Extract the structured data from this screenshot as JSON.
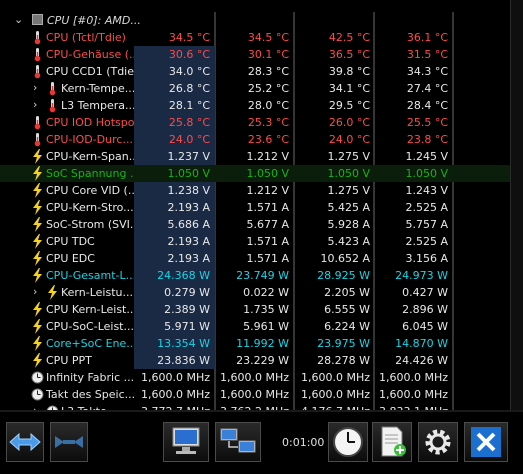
{
  "window": {
    "title": ""
  },
  "header": {
    "label": "CPU [#0]: AMD..."
  },
  "colors": {
    "red": "#ff4b4b",
    "green": "#19b219",
    "cyan": "#15d6e8",
    "white": "#e8e8e8",
    "highlight": "#1a2a44"
  },
  "rows": [
    {
      "label": "CPU (Tctl/Tdie)",
      "v": [
        "34.5 °C",
        "34.5 °C",
        "42.5 °C",
        "36.1 °C"
      ],
      "color": "red",
      "icon": "thermometer-icon",
      "indent": 0,
      "chev": false,
      "hl": false
    },
    {
      "label": "CPU-Gehäuse (...",
      "v": [
        "30.6 °C",
        "30.1 °C",
        "36.5 °C",
        "31.5 °C"
      ],
      "color": "red",
      "icon": "thermometer-icon",
      "indent": 0,
      "chev": false,
      "hl": true
    },
    {
      "label": "CPU CCD1 (Tdie)",
      "v": [
        "34.0 °C",
        "28.3 °C",
        "39.8 °C",
        "34.3 °C"
      ],
      "color": "white",
      "icon": "thermometer-icon",
      "indent": 0,
      "chev": false,
      "hl": true
    },
    {
      "label": "Kern-Tempe...",
      "v": [
        "26.8 °C",
        "25.2 °C",
        "34.1 °C",
        "27.4 °C"
      ],
      "color": "white",
      "icon": "thermometer-icon",
      "indent": 1,
      "chev": true,
      "hl": true
    },
    {
      "label": "L3 Tempera...",
      "v": [
        "28.1 °C",
        "28.0 °C",
        "29.5 °C",
        "28.4 °C"
      ],
      "color": "white",
      "icon": "thermometer-icon",
      "indent": 1,
      "chev": true,
      "hl": true
    },
    {
      "label": "CPU IOD Hotspot",
      "v": [
        "25.8 °C",
        "25.3 °C",
        "26.0 °C",
        "25.5 °C"
      ],
      "color": "red",
      "icon": "thermometer-icon",
      "indent": 0,
      "chev": false,
      "hl": true
    },
    {
      "label": "CPU-IOD-Durc...",
      "v": [
        "24.0 °C",
        "23.6 °C",
        "24.0 °C",
        "23.8 °C"
      ],
      "color": "red",
      "icon": "thermometer-icon",
      "indent": 0,
      "chev": false,
      "hl": true
    },
    {
      "label": "CPU-Kern-Span...",
      "v": [
        "1.237 V",
        "1.212 V",
        "1.275 V",
        "1.245 V"
      ],
      "color": "white",
      "icon": "lightning-icon",
      "indent": 0,
      "chev": false,
      "hl": true
    },
    {
      "label": "SoC Spannung ...",
      "v": [
        "1.050 V",
        "1.050 V",
        "1.050 V",
        "1.050 V"
      ],
      "color": "green",
      "icon": "lightning-icon",
      "indent": 0,
      "chev": false,
      "hl": false,
      "green_bg": true
    },
    {
      "label": "CPU Core VID (...",
      "v": [
        "1.238 V",
        "1.212 V",
        "1.275 V",
        "1.243 V"
      ],
      "color": "white",
      "icon": "lightning-icon",
      "indent": 0,
      "chev": false,
      "hl": true
    },
    {
      "label": "CPU-Kern-Stro...",
      "v": [
        "2.193 A",
        "1.571 A",
        "5.425 A",
        "2.525 A"
      ],
      "color": "white",
      "icon": "lightning-icon",
      "indent": 0,
      "chev": false,
      "hl": true
    },
    {
      "label": "SoC-Strom (SVI...",
      "v": [
        "5.686 A",
        "5.677 A",
        "5.928 A",
        "5.757 A"
      ],
      "color": "white",
      "icon": "lightning-icon",
      "indent": 0,
      "chev": false,
      "hl": true
    },
    {
      "label": "CPU TDC",
      "v": [
        "2.193 A",
        "1.571 A",
        "5.423 A",
        "2.525 A"
      ],
      "color": "white",
      "icon": "lightning-icon",
      "indent": 0,
      "chev": false,
      "hl": true
    },
    {
      "label": "CPU EDC",
      "v": [
        "2.193 A",
        "1.571 A",
        "10.652 A",
        "3.156 A"
      ],
      "color": "white",
      "icon": "lightning-icon",
      "indent": 0,
      "chev": false,
      "hl": true
    },
    {
      "label": "CPU-Gesamt-L...",
      "v": [
        "24.368 W",
        "23.749 W",
        "28.925 W",
        "24.973 W"
      ],
      "color": "cyan",
      "icon": "lightning-icon",
      "indent": 0,
      "chev": false,
      "hl": true
    },
    {
      "label": "Kern-Leistu...",
      "v": [
        "0.279 W",
        "0.022 W",
        "2.205 W",
        "0.427 W"
      ],
      "color": "white",
      "icon": "lightning-icon",
      "indent": 1,
      "chev": true,
      "hl": true
    },
    {
      "label": "CPU Kern-Leist...",
      "v": [
        "2.389 W",
        "1.735 W",
        "6.555 W",
        "2.896 W"
      ],
      "color": "white",
      "icon": "lightning-icon",
      "indent": 0,
      "chev": false,
      "hl": true
    },
    {
      "label": "CPU-SoC-Leist...",
      "v": [
        "5.971 W",
        "5.961 W",
        "6.224 W",
        "6.045 W"
      ],
      "color": "white",
      "icon": "lightning-icon",
      "indent": 0,
      "chev": false,
      "hl": true
    },
    {
      "label": "Core+SoC Ene...",
      "v": [
        "13.354 W",
        "11.992 W",
        "23.975 W",
        "14.870 W"
      ],
      "color": "cyan",
      "icon": "lightning-icon",
      "indent": 0,
      "chev": false,
      "hl": true
    },
    {
      "label": "CPU PPT",
      "v": [
        "23.836 W",
        "23.229 W",
        "28.278 W",
        "24.426 W"
      ],
      "color": "white",
      "icon": "lightning-icon",
      "indent": 0,
      "chev": false,
      "hl": true
    },
    {
      "label": "Infinity Fabric ...",
      "v": [
        "1,600.0 MHz",
        "1,600.0 MHz",
        "1,600.0 MHz",
        "1,600.0 MHz"
      ],
      "color": "white",
      "icon": "clock-icon",
      "indent": 0,
      "chev": false,
      "hl": false
    },
    {
      "label": "Takt des Speic...",
      "v": [
        "1,600.0 MHz",
        "1,600.0 MHz",
        "1,600.0 MHz",
        "1,600.0 MHz"
      ],
      "color": "white",
      "icon": "clock-icon",
      "indent": 0,
      "chev": false,
      "hl": false
    },
    {
      "label": "L3 Takte",
      "v": [
        "3,772.7 MHz",
        "3,762.2 MHz",
        "4,176.7 MHz",
        "3,833.1 MHz"
      ],
      "color": "white",
      "icon": "clock-icon",
      "indent": 1,
      "chev": true,
      "hl": false
    }
  ],
  "toolbar": {
    "timer": "0:01:00"
  }
}
